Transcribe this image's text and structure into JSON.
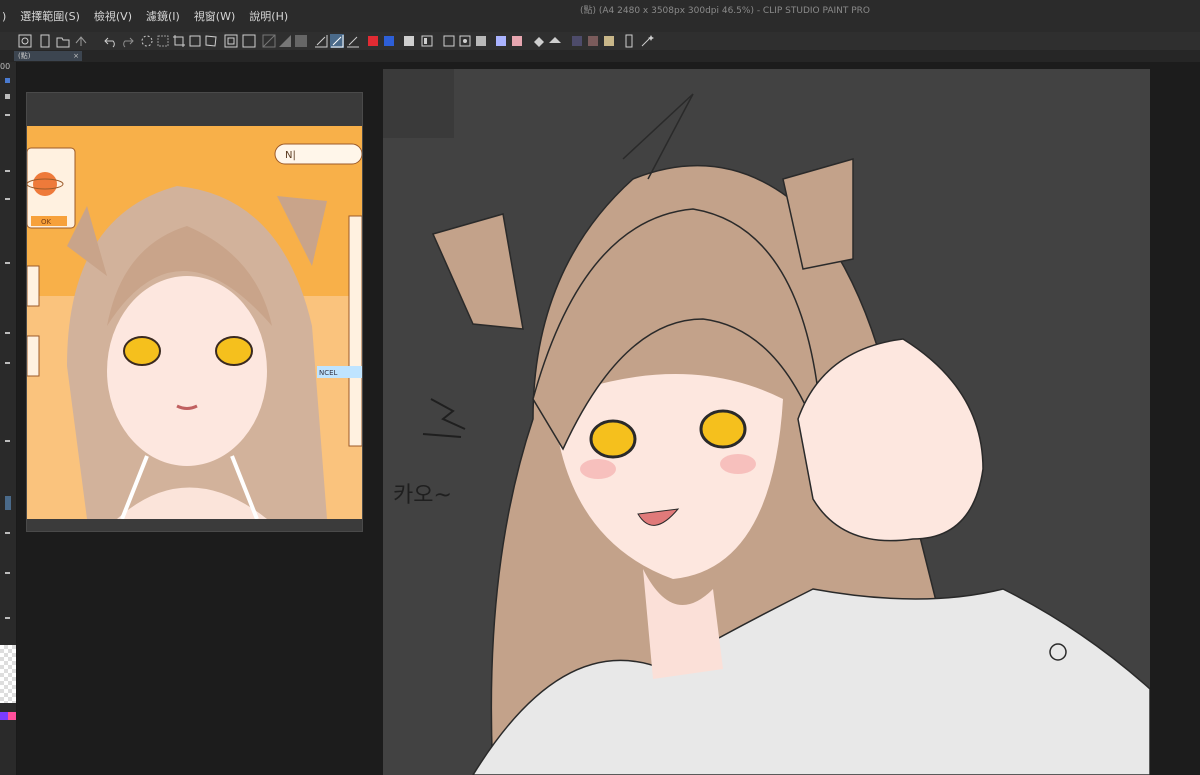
{
  "window": {
    "title": "(點) (A4 2480 x 3508px 300dpi 46.5%) - CLIP STUDIO PAINT PRO"
  },
  "menu": {
    "edit_tail": ")",
    "select": "選擇範圍(S)",
    "view": "檢視(V)",
    "filter": "濾鏡(I)",
    "window": "視窗(W)",
    "help": "說明(H)"
  },
  "tab": {
    "label": "(點)",
    "close": "×"
  },
  "toolbar": {
    "colors": {
      "main_red": "#e12b33",
      "main_blue": "#2d5fd8",
      "sub_lavender": "#aab3ff",
      "sub_pink": "#e7a6b0",
      "swatch_1": "#4d4b6a",
      "swatch_2": "#7a5b5b",
      "swatch_3": "#c9b789"
    }
  },
  "navigator": {
    "preview_input": "N|",
    "preview_ok": "OK",
    "preview_cancel": "NCEL"
  },
  "canvas": {
    "sound_text": "카오~",
    "background": "#424242"
  },
  "left_panel": {
    "zoom_fragment": "00"
  }
}
